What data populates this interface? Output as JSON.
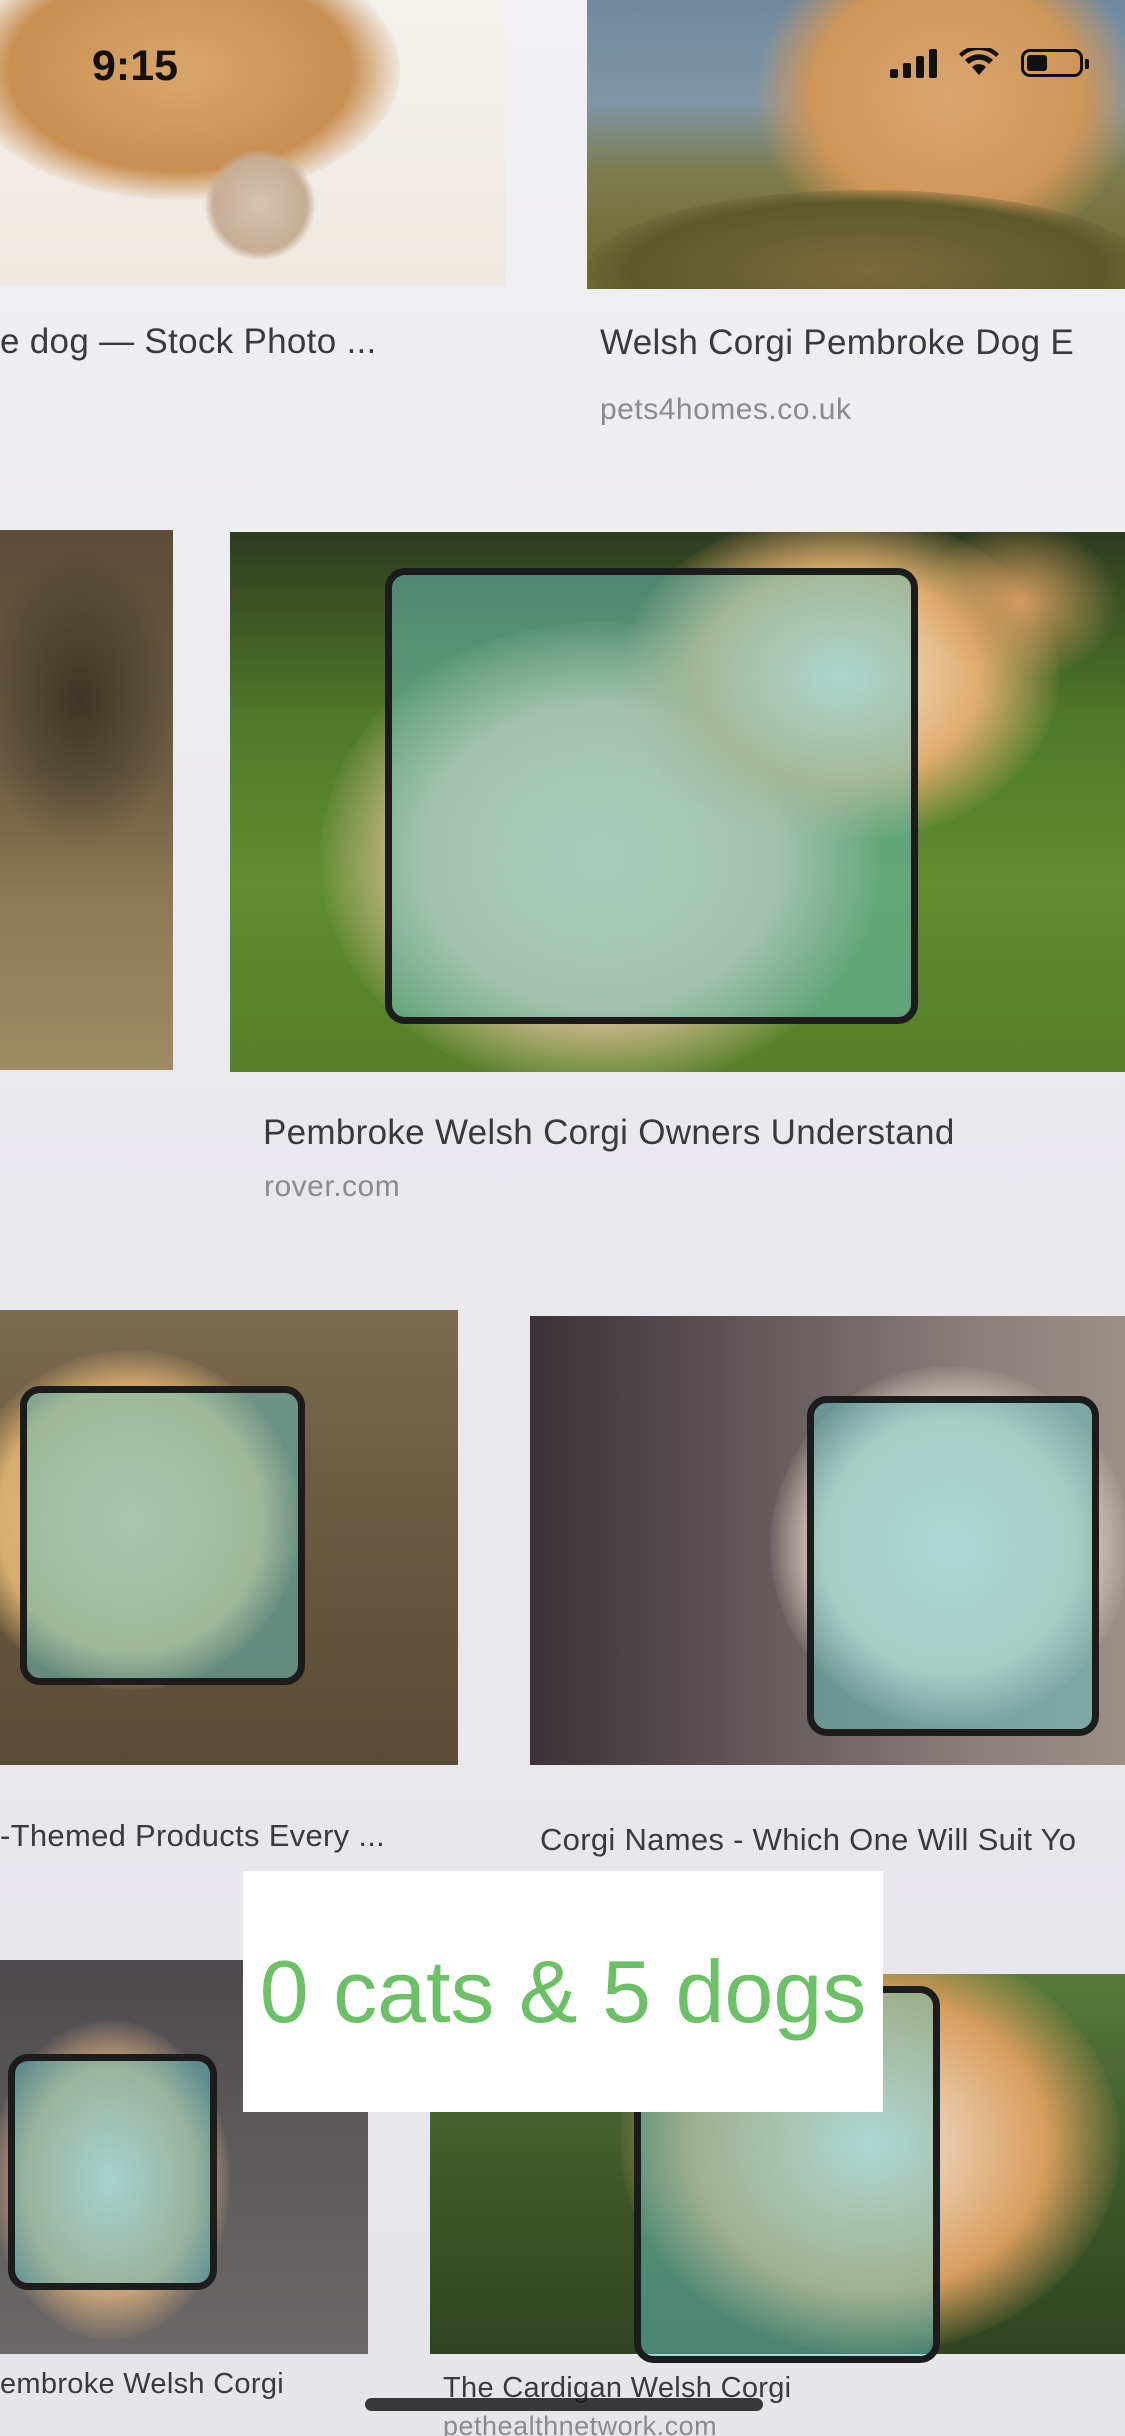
{
  "status_bar": {
    "time": "9:15"
  },
  "results": [
    {
      "title": "e dog — Stock Photo ...",
      "source": ""
    },
    {
      "title": "Welsh Corgi Pembroke Dog E",
      "source": "pets4homes.co.uk"
    },
    {
      "title": "Pembroke Welsh Corgi Owners Understand",
      "source": "rover.com"
    },
    {
      "title": "-Themed Products Every ...",
      "source": ""
    },
    {
      "title": "Corgi Names - Which One Will Suit Yo",
      "source": ""
    },
    {
      "title": "embroke Welsh Corgi",
      "source": ""
    },
    {
      "title": "The Cardigan Welsh Corgi",
      "source": "pethealthnetwork.com"
    }
  ],
  "detection": {
    "count_label": "0 cats & 5 dogs",
    "cats": 0,
    "dogs": 5
  },
  "colors": {
    "count_text": "#6cc167",
    "box_fill": "#68c4c4",
    "box_border": "#1c1c1c"
  },
  "icons": [
    "signal-icon",
    "wifi-icon",
    "battery-icon"
  ]
}
